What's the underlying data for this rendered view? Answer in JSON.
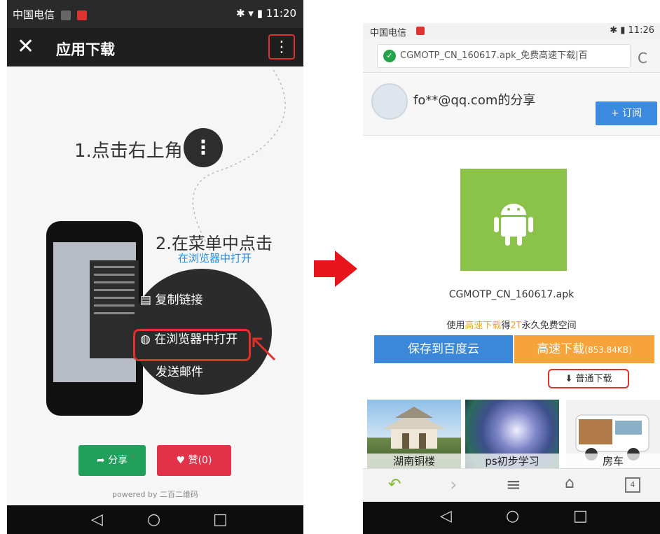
{
  "left": {
    "status": {
      "carrier": "中国电信",
      "time": "11:20"
    },
    "appbar": {
      "close": "✕",
      "title": "应用下载",
      "menu": "⋮"
    },
    "step1": "1.点击右上角",
    "step1_icon": "⋮",
    "step2": "2.在菜单中点击",
    "step2_sub": "在浏览器中打开",
    "menu_items": [
      "复制链接",
      "在浏览器中打开",
      "发送邮件"
    ],
    "share_label": "分享",
    "like_label": "赞(0)",
    "powered": "powered by 二百二维码",
    "nav": [
      "◁",
      "○",
      "□"
    ]
  },
  "arrow_color": "#e8141b",
  "right": {
    "status": {
      "carrier": "中国电信",
      "time": "11:26"
    },
    "url": "CGMOTP_CN_160617.apk_免费高速下载|百",
    "refresh": "C",
    "username": "fo**@qq.com的分享",
    "subscribe": "+ 订阅",
    "apk_name": "CGMOTP_CN_160617.apk",
    "promo": {
      "a": "使用",
      "b": "高速下载",
      "c": "得",
      "d": "2T",
      "e": "永久免费空间"
    },
    "save_btn": "保存到百度云",
    "fast_btn": "高速下载",
    "fast_size": "(853.84KB)",
    "normal_dl": "普通下载",
    "thumbs": [
      "湖南铜楼",
      "ps初步学习",
      "房车"
    ],
    "toolbar": [
      "↶",
      "›",
      "≡",
      "⌂",
      "4"
    ],
    "nav": [
      "◁",
      "○",
      "□"
    ]
  }
}
